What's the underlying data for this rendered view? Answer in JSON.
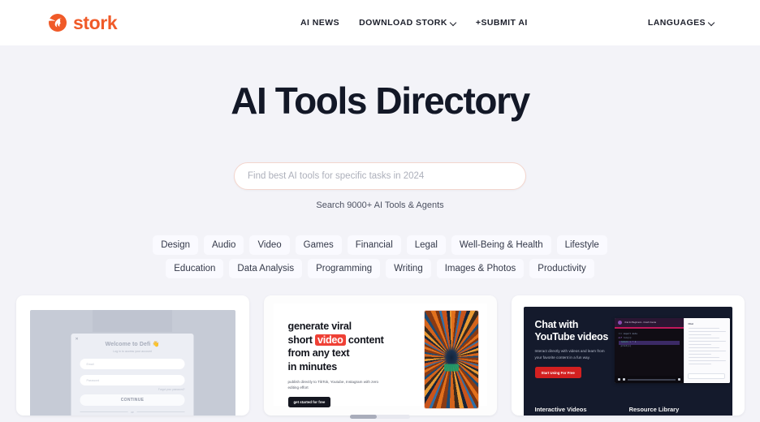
{
  "header": {
    "logo": {
      "icon": "stork-bird-icon",
      "text": "stork",
      "color": "#f05a28"
    },
    "nav": [
      {
        "label": "AI NEWS",
        "has_caret": false
      },
      {
        "label": "DOWNLOAD STORK",
        "has_caret": true
      },
      {
        "label": "+SUBMIT AI",
        "has_caret": false
      }
    ],
    "languages": {
      "label": "LANGUAGES",
      "has_caret": true
    }
  },
  "hero": {
    "title": "AI Tools Directory",
    "search": {
      "placeholder": "Find best AI tools for specific tasks in 2024",
      "value": "",
      "subtitle": "Search 9000+ AI Tools & Agents"
    }
  },
  "tags": [
    "Design",
    "Audio",
    "Video",
    "Games",
    "Financial",
    "Legal",
    "Well-Being & Health",
    "Lifestyle",
    "Education",
    "Data Analysis",
    "Programming",
    "Writing",
    "Images & Photos",
    "Productivity"
  ],
  "cards": [
    {
      "name": "defi-login-card",
      "title": "Welcome to Defi",
      "emoji": "👋",
      "subtitle": "Log in to access your account",
      "fields": [
        {
          "placeholder": "Email"
        },
        {
          "placeholder": "Password"
        }
      ],
      "forgot_label": "Forgot your password?",
      "button_label": "CONTINUE",
      "divider_label": "or"
    },
    {
      "name": "viral-video-card",
      "heading_line1": "generate viral",
      "heading_line2_pre": "short ",
      "heading_highlight": "video",
      "heading_line2_post": " content",
      "heading_line3": "from any text",
      "heading_line4": "in minutes",
      "paragraph": "publish directly to TikTok, Youtube, Instagram with zero editing effort",
      "button_label": "get started for free",
      "highlight_color": "#ef4136"
    },
    {
      "name": "chat-youtube-card",
      "heading": "Chat with YouTube videos",
      "paragraph": "Interact directly with videos and learn from your favorite content in a fun way.",
      "button_label": "Start Using For Free",
      "button_color": "#d32020",
      "app_preview": {
        "video_title": "Chat for Beginners - Crash Course",
        "panel_title": "Chat",
        "input_placeholder": "Type your question"
      },
      "footer_items": [
        "Interactive Videos",
        "Resource Library"
      ]
    }
  ],
  "scroll_indicator": {
    "name": "carousel-scrollbar"
  }
}
